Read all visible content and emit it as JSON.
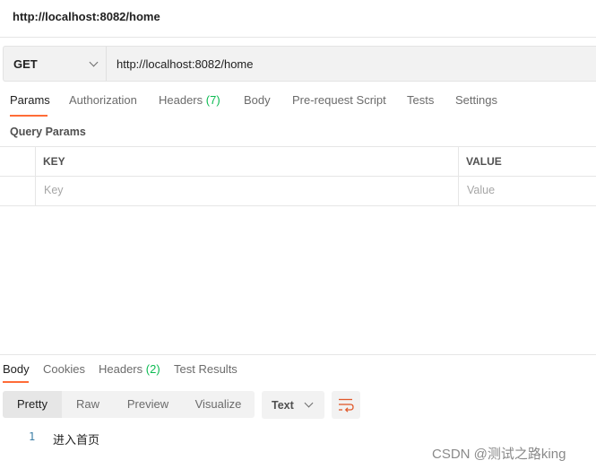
{
  "title": "http://localhost:8082/home",
  "request": {
    "method": "GET",
    "url": "http://localhost:8082/home"
  },
  "request_tabs": [
    {
      "label": "Params",
      "count": null,
      "active": true
    },
    {
      "label": "Authorization",
      "count": null,
      "active": false
    },
    {
      "label": "Headers",
      "count": "(7)",
      "active": false
    },
    {
      "label": "Body",
      "count": null,
      "active": false
    },
    {
      "label": "Pre-request Script",
      "count": null,
      "active": false
    },
    {
      "label": "Tests",
      "count": null,
      "active": false
    },
    {
      "label": "Settings",
      "count": null,
      "active": false
    }
  ],
  "query_params": {
    "section_label": "Query Params",
    "columns": [
      "KEY",
      "VALUE"
    ],
    "placeholder_row": {
      "key": "Key",
      "value": "Value"
    }
  },
  "response_tabs": [
    {
      "label": "Body",
      "count": null,
      "active": true
    },
    {
      "label": "Cookies",
      "count": null,
      "active": false
    },
    {
      "label": "Headers",
      "count": "(2)",
      "active": false
    },
    {
      "label": "Test Results",
      "count": null,
      "active": false
    }
  ],
  "view_modes": [
    {
      "label": "Pretty",
      "active": true
    },
    {
      "label": "Raw",
      "active": false
    },
    {
      "label": "Preview",
      "active": false
    },
    {
      "label": "Visualize",
      "active": false
    }
  ],
  "format": {
    "selected": "Text"
  },
  "wrap_icon": "wrap-lines-icon",
  "response_body": [
    {
      "line": "1",
      "text": "进入首页"
    }
  ],
  "watermark": "CSDN @测试之路king",
  "colors": {
    "accent": "#ff6c37",
    "count_green": "#0cbb52",
    "wrap_icon": "#e0582a",
    "line_number": "#3d7fa6"
  }
}
